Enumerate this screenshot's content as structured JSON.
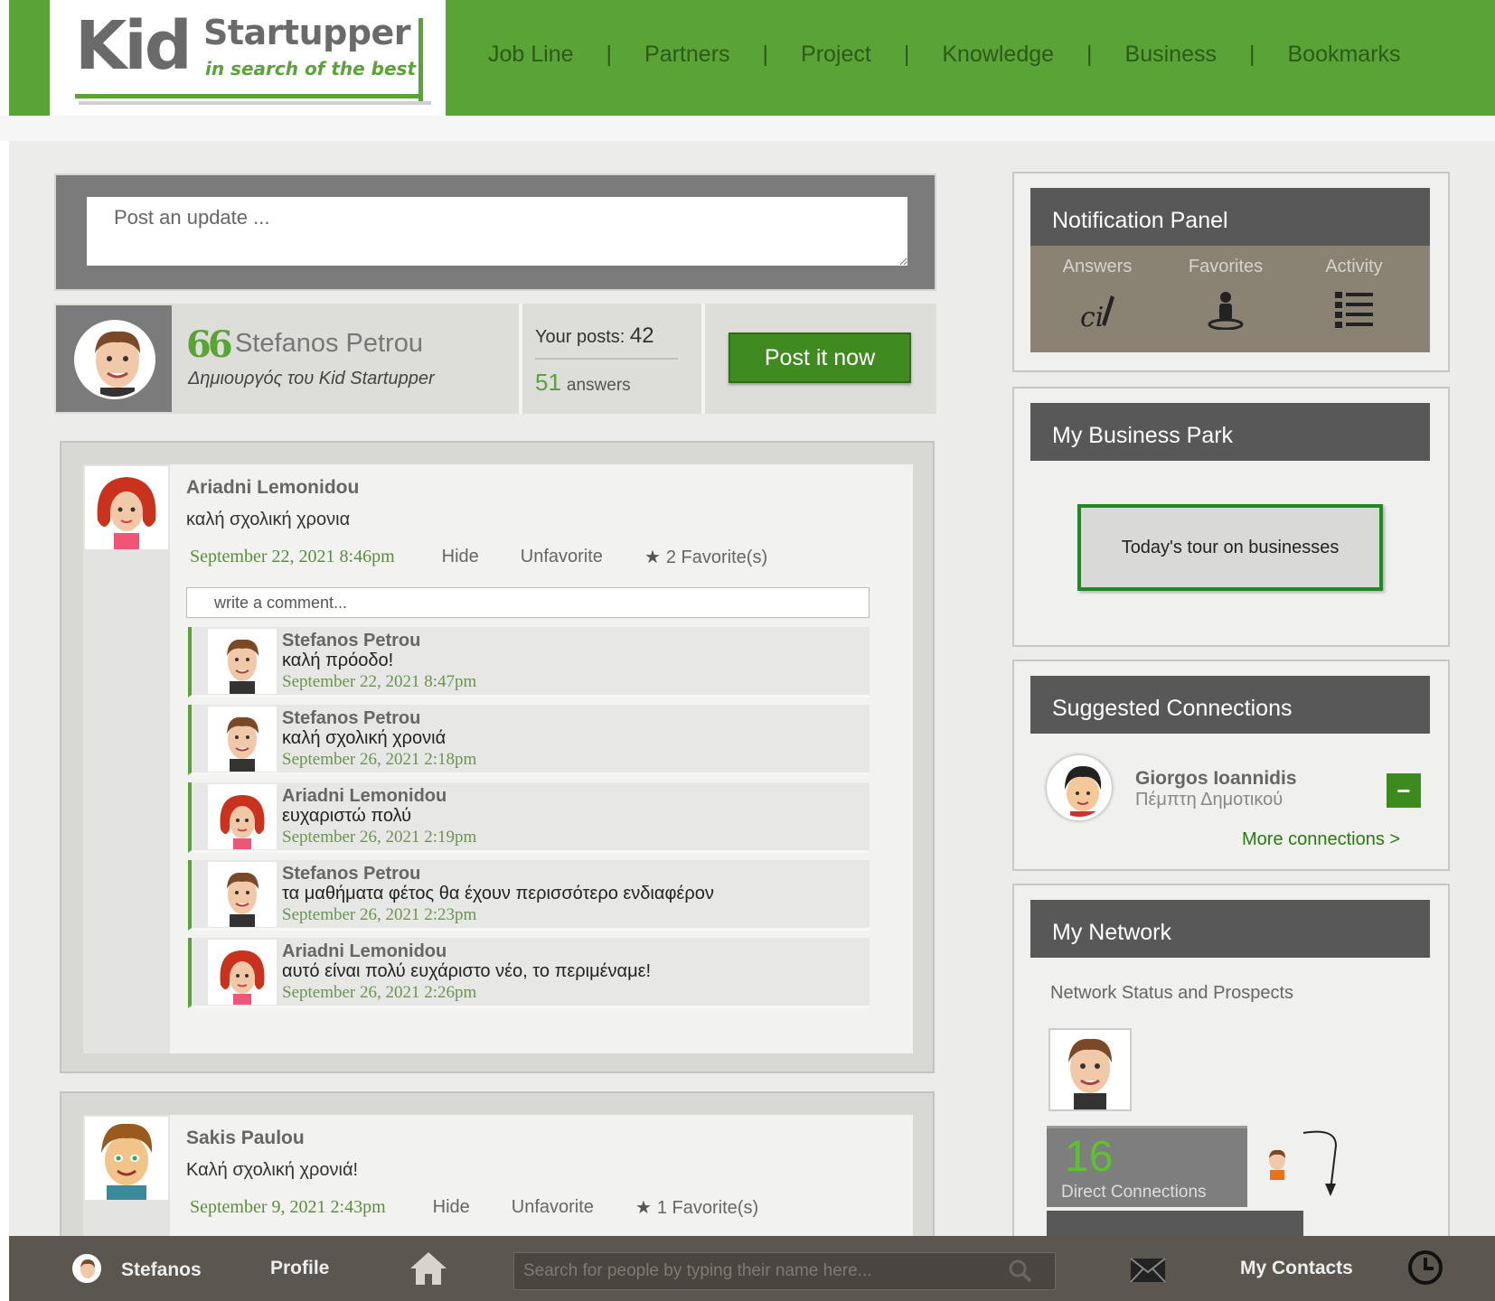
{
  "header": {
    "logo_kid": "Kid",
    "logo_startupper": "Startupper",
    "logo_tagline": "in search of the best",
    "nav": [
      {
        "label": "Job Line"
      },
      {
        "label": "Partners"
      },
      {
        "label": "Project"
      },
      {
        "label": "Knowledge"
      },
      {
        "label": "Business"
      },
      {
        "label": "Bookmarks"
      }
    ],
    "nav_separator": "|",
    "colors": {
      "brand_green": "#5aa337",
      "dark_green": "#3f8b1f"
    }
  },
  "composer": {
    "placeholder": "Post an update ..."
  },
  "profile": {
    "quote_mark": "66",
    "name": "Stefanos Petrou",
    "role": "Δημιουργός του Kid Startupper",
    "posts_label": "Your posts:",
    "posts_count": "42",
    "answers_count": "51",
    "answers_label": "answers",
    "post_button": "Post it now"
  },
  "feed": [
    {
      "author": "Ariadni Lemonidou",
      "avatar": "girl-red-hair-avatar",
      "text": "καλή σχολική χρονια",
      "date": "September 22, 2021 8:46pm",
      "hide_label": "Hide",
      "unfavorite_label": "Unfavorite",
      "favorites": "2 Favorite(s)",
      "comment_placeholder": "write a comment...",
      "comments": [
        {
          "author": "Stefanos Petrou",
          "text": "καλή πρόοδο!",
          "date": "September 22, 2021 8:47pm",
          "avatar": "boy-avatar"
        },
        {
          "author": "Stefanos Petrou",
          "text": "καλή σχολική χρονιά",
          "date": "September 26, 2021 2:18pm",
          "avatar": "boy-avatar"
        },
        {
          "author": "Ariadni Lemonidou",
          "text": "ευχαριστώ πολύ",
          "date": "September 26, 2021 2:19pm",
          "avatar": "girl-red-hair-avatar"
        },
        {
          "author": "Stefanos Petrou",
          "text": "τα μαθήματα φέτος θα έχουν περισσότερο ενδιαφέρον",
          "date": "September 26, 2021 2:23pm",
          "avatar": "boy-avatar"
        },
        {
          "author": "Ariadni Lemonidou",
          "text": "αυτό είναι πολύ ευχάριστο νέο, το περιμέναμε!",
          "date": "September 26, 2021 2:26pm",
          "avatar": "girl-red-hair-avatar"
        }
      ]
    },
    {
      "author": "Sakis Paulou",
      "avatar": "cartoon-boy-avatar",
      "text": "Καλή σχολική χρονιά!",
      "date": "September 9, 2021 2:43pm",
      "hide_label": "Hide",
      "unfavorite_label": "Unfavorite",
      "favorites": "1 Favorite(s)"
    }
  ],
  "sidebar": {
    "notification_panel": {
      "title": "Notification Panel",
      "items": [
        {
          "label": "Answers",
          "icon": "answers-icon"
        },
        {
          "label": "Favorites",
          "icon": "favorites-icon"
        },
        {
          "label": "Activity",
          "icon": "activity-list-icon"
        }
      ]
    },
    "business_park": {
      "title": "My Business Park",
      "tour_button": "Today's tour on businesses"
    },
    "suggested": {
      "title": "Suggested Connections",
      "name": "Giorgos Ioannidis",
      "subtitle": "Πέμπτη Δημοτικού",
      "action": "−",
      "more": "More connections >"
    },
    "network": {
      "title": "My Network",
      "subtitle": "Network Status and Prospects",
      "direct_count": "16",
      "direct_label": "Direct Connections"
    }
  },
  "bottom_bar": {
    "user": "Stefanos",
    "profile": "Profile",
    "search_placeholder": "Search for people by typing their name here...",
    "contacts": "My Contacts"
  }
}
